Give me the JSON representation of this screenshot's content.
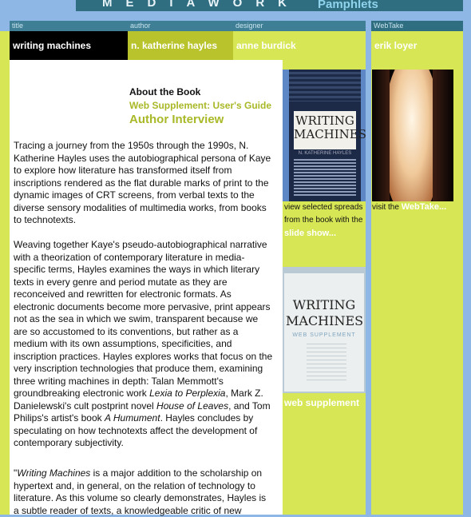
{
  "brand": {
    "name": "MEDIAWORK",
    "series": "Pamphlets"
  },
  "headers": {
    "title_label": "title",
    "title_value": "writing machines",
    "author_label": "author",
    "author_value": "n. katherine hayles",
    "designer_label": "designer",
    "designer_value": "anne burdick",
    "webtake_label": "WebTake",
    "webtake_value": "erik loyer"
  },
  "links": {
    "about": "About the Book",
    "web_supplement": "Web Supplement: User's Guide",
    "author_interview": "Author Interview"
  },
  "body": {
    "p1": "Tracing a journey from the 1950s through the 1990s, N. Katherine Hayles uses the autobiographical persona of Kaye to explore how literature has transformed itself from inscriptions rendered as the flat durable marks of print to the dynamic images of CRT screens, from verbal texts to the diverse sensory modalities of multimedia works, from books to technotexts.",
    "p2_a": "Weaving together Kaye's pseudo-autobiographical narrative with a theorization of contemporary literature in media-specific terms, Hayles examines the ways in which literary texts in every genre and period mutate as they are reconceived and rewritten for electronic formats. As electronic documents become more pervasive, print appears not as the sea in which we swim, transparent because we are so accustomed to its conventions, but rather as a medium with its own assumptions, specificities, and inscription practices. Hayles explores works that focus on the very inscription technologies that produce them, examining three writing machines in depth: Talan Memmott's groundbreaking electronic work ",
    "p2_i1": "Lexia to Perplexia",
    "p2_b": ", Mark Z. Danielewski's cult postprint novel ",
    "p2_i2": "House of Leaves",
    "p2_c": ", and Tom Philips's artist's book ",
    "p2_i3": "A Humument",
    "p2_d": ". Hayles concludes by speculating on how technotexts affect the development of contemporary subjectivity.",
    "p3_a": "\"",
    "p3_i": "Writing Machines",
    "p3_b": " is a major addition to the scholarship on hypertext and, in general, on the relation of technology to literature. As this volume so clearly demonstrates, Hayles is a subtle reader of texts, a knowledgeable critic of new"
  },
  "sidebar": {
    "book1_title": "WRITING MACHINES",
    "book1_author": "N. KATHERINE HAYLES",
    "cap1_text": "view selected spreads from the book with the",
    "cap1_link": "slide show...",
    "book2_title": "WRITING MACHINES",
    "book2_sub": "WEB SUPPLEMENT",
    "cap2_link": "web supplement",
    "cap3_text": "visit the",
    "cap3_link": "WebTake..."
  },
  "colors": {
    "accent_green": "#d7e655",
    "header_teal": "#3f7f95",
    "background_blue": "#8fb7e6",
    "link_olive": "#a9b827"
  }
}
